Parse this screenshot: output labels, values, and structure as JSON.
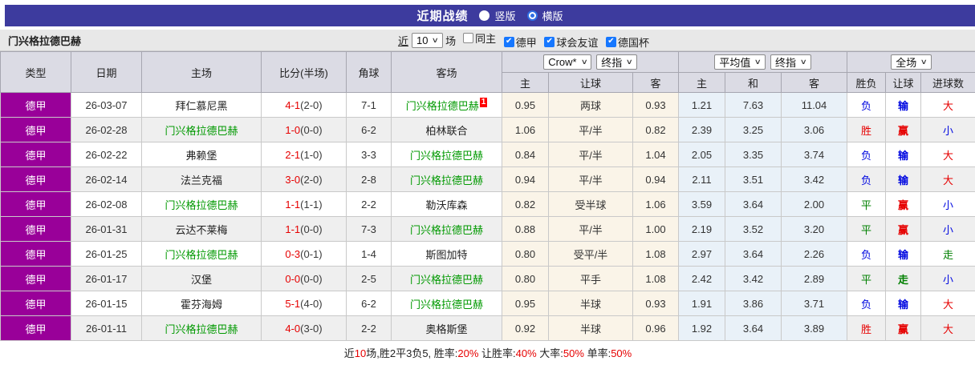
{
  "topbar": {
    "title": "近期战绩",
    "radios": [
      {
        "label": "竖版",
        "selected": false
      },
      {
        "label": "横版",
        "selected": true
      }
    ]
  },
  "controls": {
    "team_name": "门兴格拉德巴赫",
    "near_link": "近",
    "count_value": "10",
    "games_label": "场",
    "filters": [
      {
        "label": "同主",
        "checked": false
      },
      {
        "label": "德甲",
        "checked": true
      },
      {
        "label": "球会友谊",
        "checked": true
      },
      {
        "label": "德国杯",
        "checked": true
      }
    ]
  },
  "table": {
    "headers": {
      "static": [
        "类型",
        "日期",
        "主场",
        "比分(半场)",
        "角球",
        "客场"
      ],
      "groups": [
        {
          "selects": [
            {
              "label": "Crow*"
            },
            {
              "label": "终指"
            }
          ],
          "subcols": [
            "主",
            "让球",
            "客"
          ]
        },
        {
          "selects": [
            {
              "label": "平均值"
            },
            {
              "label": "终指"
            }
          ],
          "subcols": [
            "主",
            "和",
            "客"
          ]
        },
        {
          "selects": [
            {
              "label": "全场"
            }
          ],
          "subcols": [
            "胜负",
            "让球",
            "进球数"
          ]
        }
      ]
    },
    "rows": [
      {
        "league": "德甲",
        "date": "26-03-07",
        "home": {
          "t": "拜仁慕尼黑",
          "self": false
        },
        "score_ft": "4-1",
        "score_ht": "(2-0)",
        "corner": "7-1",
        "away": {
          "t": "门兴格拉德巴赫",
          "self": true,
          "badge": "1"
        },
        "o1": "0.95",
        "o2": "两球",
        "o3": "0.93",
        "a1": "1.21",
        "a2": "7.63",
        "a3": "11.04",
        "r1": {
          "t": "负",
          "c": "blue"
        },
        "r2": {
          "t": "输",
          "c": "blue"
        },
        "r3": {
          "t": "大",
          "c": "red"
        }
      },
      {
        "league": "德甲",
        "date": "26-02-28",
        "home": {
          "t": "门兴格拉德巴赫",
          "self": true
        },
        "score_ft": "1-0",
        "score_ht": "(0-0)",
        "corner": "6-2",
        "away": {
          "t": "柏林联合",
          "self": false
        },
        "o1": "1.06",
        "o2": "平/半",
        "o3": "0.82",
        "a1": "2.39",
        "a2": "3.25",
        "a3": "3.06",
        "r1": {
          "t": "胜",
          "c": "red"
        },
        "r2": {
          "t": "赢",
          "c": "red"
        },
        "r3": {
          "t": "小",
          "c": "blue"
        }
      },
      {
        "league": "德甲",
        "date": "26-02-22",
        "home": {
          "t": "弗赖堡",
          "self": false
        },
        "score_ft": "2-1",
        "score_ht": "(1-0)",
        "corner": "3-3",
        "away": {
          "t": "门兴格拉德巴赫",
          "self": true
        },
        "o1": "0.84",
        "o2": "平/半",
        "o3": "1.04",
        "a1": "2.05",
        "a2": "3.35",
        "a3": "3.74",
        "r1": {
          "t": "负",
          "c": "blue"
        },
        "r2": {
          "t": "输",
          "c": "blue"
        },
        "r3": {
          "t": "大",
          "c": "red"
        }
      },
      {
        "league": "德甲",
        "date": "26-02-14",
        "home": {
          "t": "法兰克福",
          "self": false
        },
        "score_ft": "3-0",
        "score_ht": "(2-0)",
        "corner": "2-8",
        "away": {
          "t": "门兴格拉德巴赫",
          "self": true
        },
        "o1": "0.94",
        "o2": "平/半",
        "o3": "0.94",
        "a1": "2.11",
        "a2": "3.51",
        "a3": "3.42",
        "r1": {
          "t": "负",
          "c": "blue"
        },
        "r2": {
          "t": "输",
          "c": "blue"
        },
        "r3": {
          "t": "大",
          "c": "red"
        }
      },
      {
        "league": "德甲",
        "date": "26-02-08",
        "home": {
          "t": "门兴格拉德巴赫",
          "self": true
        },
        "score_ft": "1-1",
        "score_ht": "(1-1)",
        "corner": "2-2",
        "away": {
          "t": "勒沃库森",
          "self": false
        },
        "o1": "0.82",
        "o2": "受半球",
        "o3": "1.06",
        "a1": "3.59",
        "a2": "3.64",
        "a3": "2.00",
        "r1": {
          "t": "平",
          "c": "green"
        },
        "r2": {
          "t": "赢",
          "c": "red"
        },
        "r3": {
          "t": "小",
          "c": "blue"
        }
      },
      {
        "league": "德甲",
        "date": "26-01-31",
        "home": {
          "t": "云达不莱梅",
          "self": false
        },
        "score_ft": "1-1",
        "score_ht": "(0-0)",
        "corner": "7-3",
        "away": {
          "t": "门兴格拉德巴赫",
          "self": true
        },
        "o1": "0.88",
        "o2": "平/半",
        "o3": "1.00",
        "a1": "2.19",
        "a2": "3.52",
        "a3": "3.20",
        "r1": {
          "t": "平",
          "c": "green"
        },
        "r2": {
          "t": "赢",
          "c": "red"
        },
        "r3": {
          "t": "小",
          "c": "blue"
        }
      },
      {
        "league": "德甲",
        "date": "26-01-25",
        "home": {
          "t": "门兴格拉德巴赫",
          "self": true
        },
        "score_ft": "0-3",
        "score_ht": "(0-1)",
        "corner": "1-4",
        "away": {
          "t": "斯图加特",
          "self": false
        },
        "o1": "0.80",
        "o2": "受平/半",
        "o3": "1.08",
        "a1": "2.97",
        "a2": "3.64",
        "a3": "2.26",
        "r1": {
          "t": "负",
          "c": "blue"
        },
        "r2": {
          "t": "输",
          "c": "blue"
        },
        "r3": {
          "t": "走",
          "c": "green"
        }
      },
      {
        "league": "德甲",
        "date": "26-01-17",
        "home": {
          "t": "汉堡",
          "self": false
        },
        "score_ft": "0-0",
        "score_ht": "(0-0)",
        "corner": "2-5",
        "away": {
          "t": "门兴格拉德巴赫",
          "self": true
        },
        "o1": "0.80",
        "o2": "平手",
        "o3": "1.08",
        "a1": "2.42",
        "a2": "3.42",
        "a3": "2.89",
        "r1": {
          "t": "平",
          "c": "green"
        },
        "r2": {
          "t": "走",
          "c": "green"
        },
        "r3": {
          "t": "小",
          "c": "blue"
        }
      },
      {
        "league": "德甲",
        "date": "26-01-15",
        "home": {
          "t": "霍芬海姆",
          "self": false
        },
        "score_ft": "5-1",
        "score_ht": "(4-0)",
        "corner": "6-2",
        "away": {
          "t": "门兴格拉德巴赫",
          "self": true
        },
        "o1": "0.95",
        "o2": "半球",
        "o3": "0.93",
        "a1": "1.91",
        "a2": "3.86",
        "a3": "3.71",
        "r1": {
          "t": "负",
          "c": "blue"
        },
        "r2": {
          "t": "输",
          "c": "blue"
        },
        "r3": {
          "t": "大",
          "c": "red"
        }
      },
      {
        "league": "德甲",
        "date": "26-01-11",
        "home": {
          "t": "门兴格拉德巴赫",
          "self": true
        },
        "score_ft": "4-0",
        "score_ht": "(3-0)",
        "corner": "2-2",
        "away": {
          "t": "奥格斯堡",
          "self": false
        },
        "o1": "0.92",
        "o2": "半球",
        "o3": "0.96",
        "a1": "1.92",
        "a2": "3.64",
        "a3": "3.89",
        "r1": {
          "t": "胜",
          "c": "red"
        },
        "r2": {
          "t": "赢",
          "c": "red"
        },
        "r3": {
          "t": "大",
          "c": "red"
        }
      }
    ]
  },
  "summary": {
    "segments": [
      {
        "t": "近"
      },
      {
        "t": "10",
        "red": true
      },
      {
        "t": "场,胜2平3负5, 胜率:"
      },
      {
        "t": "20%",
        "red": true
      },
      {
        "t": " 让胜率:"
      },
      {
        "t": "40%",
        "red": true
      },
      {
        "t": " 大率:"
      },
      {
        "t": "50%",
        "red": true
      },
      {
        "t": " 单率:"
      },
      {
        "t": "50%",
        "red": true
      }
    ]
  },
  "colors": {
    "bar_indigo": "#3d3b9e",
    "league_purple": "#990099",
    "self_team_green": "#009900",
    "win_red": "#e60000",
    "lose_blue": "#0008e0",
    "draw_green": "#008000",
    "crow_col_bg": "#faf4e8",
    "avg_col_bg": "#e9f1f8"
  }
}
